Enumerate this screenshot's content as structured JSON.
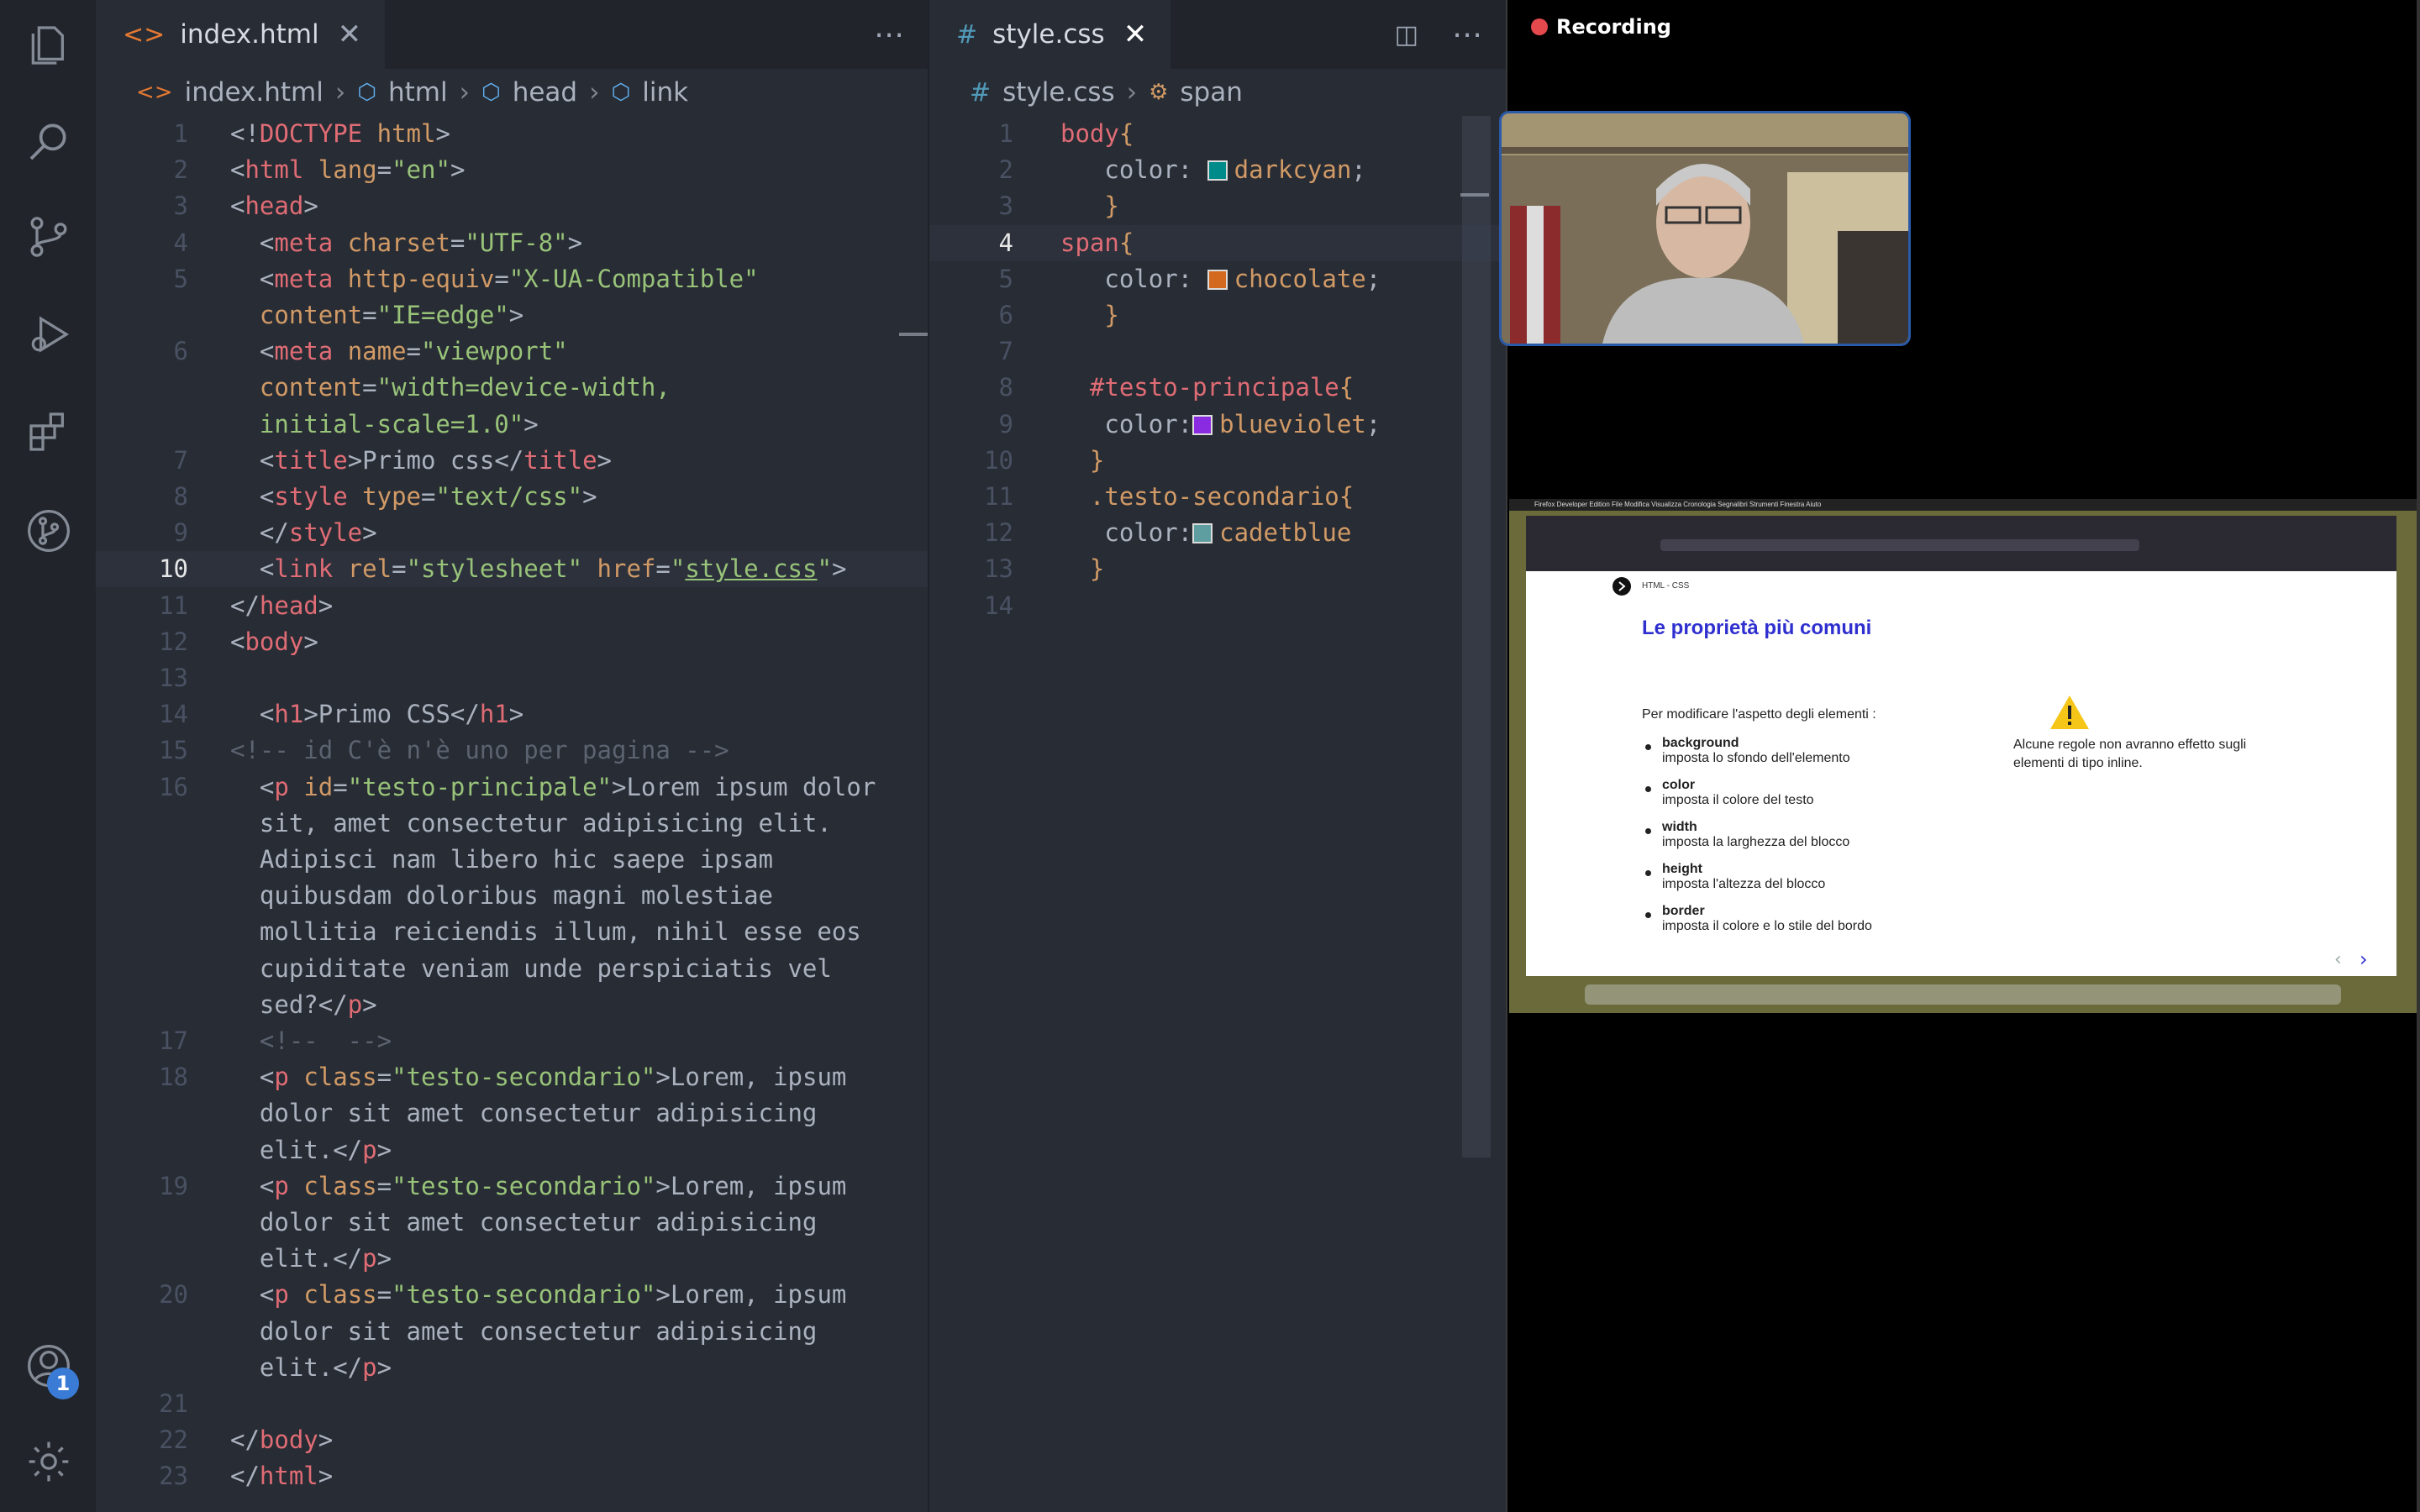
{
  "editor_left": {
    "tab": {
      "label": "index.html",
      "close": "✕"
    },
    "breadcrumb": [
      "index.html",
      "html",
      "head",
      "link"
    ],
    "lines": [
      {
        "n": "1",
        "html": "<span class='p'>&lt;!</span><span class='t'>DOCTYPE</span> <span class='a'>html</span><span class='p'>&gt;</span>"
      },
      {
        "n": "2",
        "html": "<span class='p'>&lt;</span><span class='t'>html</span> <span class='a'>lang</span>=<span class='s'>\"en\"</span><span class='p'>&gt;</span>"
      },
      {
        "n": "3",
        "html": "<span class='p'>&lt;</span><span class='t'>head</span><span class='p'>&gt;</span>"
      },
      {
        "n": "4",
        "html": "  <span class='p'>&lt;</span><span class='t'>meta</span> <span class='a'>charset</span>=<span class='s'>\"UTF-8\"</span><span class='p'>&gt;</span>"
      },
      {
        "n": "5",
        "html": "  <span class='p'>&lt;</span><span class='t'>meta</span> <span class='a'>http-equiv</span>=<span class='s'>\"X-UA-Compatible\"</span>"
      },
      {
        "n": "",
        "html": "  <span class='a'>content</span>=<span class='s'>\"IE=edge\"</span><span class='p'>&gt;</span>"
      },
      {
        "n": "6",
        "html": "  <span class='p'>&lt;</span><span class='t'>meta</span> <span class='a'>name</span>=<span class='s'>\"viewport\"</span>"
      },
      {
        "n": "",
        "html": "  <span class='a'>content</span>=<span class='s'>\"width=device-width,</span>"
      },
      {
        "n": "",
        "html": "  <span class='s'>initial-scale=1.0\"</span><span class='p'>&gt;</span>"
      },
      {
        "n": "7",
        "html": "  <span class='p'>&lt;</span><span class='t'>title</span><span class='p'>&gt;</span>Primo css<span class='p'>&lt;/</span><span class='t'>title</span><span class='p'>&gt;</span>"
      },
      {
        "n": "8",
        "html": "  <span class='p'>&lt;</span><span class='t'>style</span> <span class='a'>type</span>=<span class='s'>\"text/css\"</span><span class='p'>&gt;</span>"
      },
      {
        "n": "9",
        "html": "  <span class='p'>&lt;/</span><span class='t'>style</span><span class='p'>&gt;</span>"
      },
      {
        "n": "10",
        "html": "  <span class='p'>&lt;</span><span class='t'>link</span> <span class='a'>rel</span>=<span class='s'>\"stylesheet\"</span> <span class='a'>href</span>=<span class='s'>\"</span><span class='u'>style.css</span><span class='s'>\"</span><span class='p'>&gt;</span>",
        "active": true
      },
      {
        "n": "11",
        "html": "<span class='p'>&lt;/</span><span class='t'>head</span><span class='p'>&gt;</span>"
      },
      {
        "n": "12",
        "html": "<span class='p'>&lt;</span><span class='t'>body</span><span class='p'>&gt;</span>"
      },
      {
        "n": "13",
        "html": ""
      },
      {
        "n": "14",
        "html": "  <span class='p'>&lt;</span><span class='t'>h1</span><span class='p'>&gt;</span>Primo CSS<span class='p'>&lt;/</span><span class='t'>h1</span><span class='p'>&gt;</span>"
      },
      {
        "n": "15",
        "html": "<span class='c'>&lt;!-- id C'è n'è uno per pagina --&gt;</span>"
      },
      {
        "n": "16",
        "html": "  <span class='p'>&lt;</span><span class='t'>p</span> <span class='a'>id</span>=<span class='s'>\"testo-principale\"</span><span class='p'>&gt;</span>Lorem ipsum dolor"
      },
      {
        "n": "",
        "html": "  sit, amet consectetur adipisicing elit."
      },
      {
        "n": "",
        "html": "  Adipisci nam libero hic saepe ipsam"
      },
      {
        "n": "",
        "html": "  quibusdam doloribus magni molestiae"
      },
      {
        "n": "",
        "html": "  mollitia reiciendis illum, nihil esse eos"
      },
      {
        "n": "",
        "html": "  cupiditate veniam unde perspiciatis vel"
      },
      {
        "n": "",
        "html": "  sed?<span class='p'>&lt;/</span><span class='t'>p</span><span class='p'>&gt;</span>"
      },
      {
        "n": "17",
        "html": "  <span class='c'>&lt;!--  --&gt;</span>"
      },
      {
        "n": "18",
        "html": "  <span class='p'>&lt;</span><span class='t'>p</span> <span class='a'>class</span>=<span class='s'>\"testo-secondario\"</span><span class='p'>&gt;</span>Lorem, ipsum"
      },
      {
        "n": "",
        "html": "  dolor sit amet consectetur adipisicing"
      },
      {
        "n": "",
        "html": "  elit.<span class='p'>&lt;/</span><span class='t'>p</span><span class='p'>&gt;</span>"
      },
      {
        "n": "19",
        "html": "  <span class='p'>&lt;</span><span class='t'>p</span> <span class='a'>class</span>=<span class='s'>\"testo-secondario\"</span><span class='p'>&gt;</span>Lorem, ipsum"
      },
      {
        "n": "",
        "html": "  dolor sit amet consectetur adipisicing"
      },
      {
        "n": "",
        "html": "  elit.<span class='p'>&lt;/</span><span class='t'>p</span><span class='p'>&gt;</span>"
      },
      {
        "n": "20",
        "html": "  <span class='p'>&lt;</span><span class='t'>p</span> <span class='a'>class</span>=<span class='s'>\"testo-secondario\"</span><span class='p'>&gt;</span>Lorem, ipsum"
      },
      {
        "n": "",
        "html": "  dolor sit amet consectetur adipisicing"
      },
      {
        "n": "",
        "html": "  elit.<span class='p'>&lt;/</span><span class='t'>p</span><span class='p'>&gt;</span>"
      },
      {
        "n": "21",
        "html": ""
      },
      {
        "n": "22",
        "html": "<span class='p'>&lt;/</span><span class='t'>body</span><span class='p'>&gt;</span>"
      },
      {
        "n": "23",
        "html": "<span class='p'>&lt;/</span><span class='t'>html</span><span class='p'>&gt;</span>"
      }
    ]
  },
  "editor_right": {
    "tab": {
      "label": "style.css",
      "close": "✕"
    },
    "breadcrumb": [
      "style.css",
      "span"
    ],
    "lines": [
      {
        "n": "1",
        "html": "<span class='k'>body</span><span class='a'>{</span>"
      },
      {
        "n": "2",
        "html": "   color: <span class='swatch' style='background:#008b8b'></span><span class='a'>darkcyan</span>;"
      },
      {
        "n": "3",
        "html": "   <span class='a'>}</span>"
      },
      {
        "n": "4",
        "html": "<span class='k'>span</span><span class='a'>{</span>",
        "active": true
      },
      {
        "n": "5",
        "html": "   color: <span class='swatch' style='background:#d2691e'></span><span class='a'>chocolate</span>;"
      },
      {
        "n": "6",
        "html": "   <span class='a'>}</span>"
      },
      {
        "n": "7",
        "html": ""
      },
      {
        "n": "8",
        "html": "  <span class='k'>#testo-principale</span><span class='a'>{</span>"
      },
      {
        "n": "9",
        "html": "   color:<span class='swatch' style='background:#8a2be2'></span><span class='a'>blueviolet</span>;"
      },
      {
        "n": "10",
        "html": "  <span class='a'>}</span>"
      },
      {
        "n": "11",
        "html": "  <span class='a'>.testo-secondario</span><span class='a'>{</span>"
      },
      {
        "n": "12",
        "html": "   color:<span class='swatch' style='background:#5f9ea0'></span><span class='a'>cadetblue</span>"
      },
      {
        "n": "13",
        "html": "  <span class='a'>}</span>"
      },
      {
        "n": "14",
        "html": ""
      }
    ]
  },
  "recording": {
    "label": "Recording"
  },
  "badge": "1",
  "slide": {
    "tag": "HTML - CSS",
    "title": "Le proprietà più comuni",
    "intro": "Per modificare l'aspetto degli elementi :",
    "props": [
      {
        "name": "background",
        "desc": "imposta lo sfondo dell'elemento"
      },
      {
        "name": "color",
        "desc": "imposta il colore del testo"
      },
      {
        "name": "width",
        "desc": "imposta la larghezza  del blocco"
      },
      {
        "name": "height",
        "desc": "imposta l'altezza del blocco"
      },
      {
        "name": "border",
        "desc": "imposta il colore e lo stile del bordo"
      }
    ],
    "note": "Alcune regole non avranno effetto sugli elementi di tipo inline."
  }
}
